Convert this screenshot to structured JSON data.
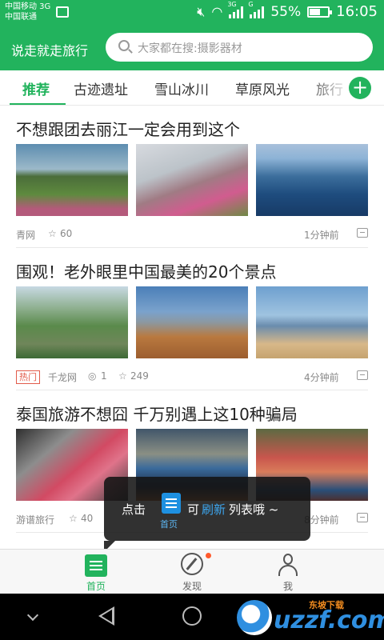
{
  "status_bar": {
    "carrier_1": "中国移动 3G",
    "carrier_2": "中国联通",
    "network_1": "3G",
    "network_2": "G",
    "battery": "55%",
    "time": "16:05"
  },
  "header": {
    "slogan": "说走就走旅行",
    "search_placeholder": "大家都在搜:摄影器材"
  },
  "tabs": [
    {
      "label": "推荐",
      "active": true
    },
    {
      "label": "古迹遗址"
    },
    {
      "label": "雪山冰川"
    },
    {
      "label": "草原风光"
    },
    {
      "label": "旅行"
    }
  ],
  "articles": [
    {
      "title": "不想跟团去丽江一定会用到这个",
      "source": "青网",
      "likes": "60",
      "time": "1分钟前"
    },
    {
      "title": "围观！老外眼里中国最美的20个景点",
      "badge": "热门",
      "source": "千龙网",
      "comments": "1",
      "likes": "249",
      "time": "4分钟前"
    },
    {
      "title": "泰国旅游不想囧 千万别遇上这10种骗局",
      "source": "游谱旅行",
      "likes": "40",
      "time": "8分钟前"
    }
  ],
  "tooltip": {
    "prefix": "点击",
    "icon_label": "首页",
    "middle": "可",
    "accent": "刷新",
    "suffix": "列表哦 ~"
  },
  "bottom_nav": [
    {
      "label": "首页",
      "icon": "home-icon",
      "active": true
    },
    {
      "label": "发现",
      "icon": "compass-icon"
    },
    {
      "label": "我",
      "icon": "user-icon"
    }
  ],
  "watermark": {
    "top": "东坡下载",
    "main": "uzzf.com"
  },
  "colors": {
    "brand_green": "#22b35d",
    "hot_red": "#e25b4a",
    "accent_blue": "#3da6ef"
  }
}
